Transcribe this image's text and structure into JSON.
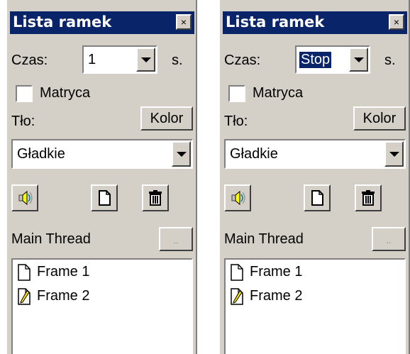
{
  "panels": [
    {
      "title": "Lista ramek",
      "close": "×",
      "time_label": "Czas:",
      "time_value": "1",
      "time_unit": "s.",
      "matrix_label": "Matryca",
      "background_label": "Tło:",
      "color_button": "Kolor",
      "background_value": "Gładkie",
      "thread_label": "Main Thread",
      "thread_button": "..",
      "frames": [
        "Frame 1",
        "Frame 2"
      ]
    },
    {
      "title": "Lista ramek",
      "close": "×",
      "time_label": "Czas:",
      "time_value": "Stop",
      "time_unit": "s.",
      "matrix_label": "Matryca",
      "background_label": "Tło:",
      "color_button": "Kolor",
      "background_value": "Gładkie",
      "thread_label": "Main Thread",
      "thread_button": "..",
      "frames": [
        "Frame 1",
        "Frame 2"
      ]
    }
  ],
  "colors": {
    "titlebar": "#0a246a",
    "face": "#d4d0c8",
    "selection": "#0a246a"
  },
  "icons": [
    "sound-icon",
    "new-frame-icon",
    "trash-icon",
    "page-icon",
    "pencil-page-icon"
  ]
}
